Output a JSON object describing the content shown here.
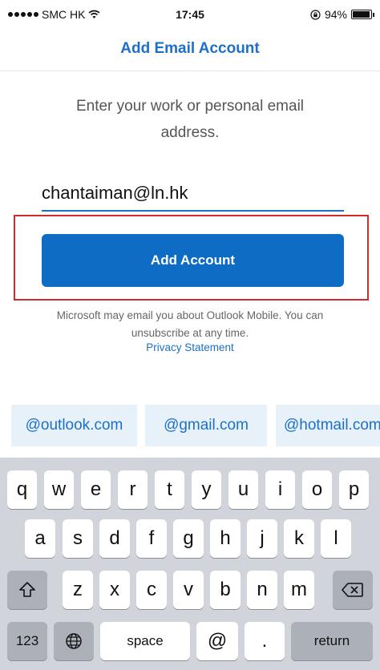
{
  "status_bar": {
    "carrier": "SMC HK",
    "time": "17:45",
    "battery": "94%",
    "battery_level": 0.94
  },
  "nav": {
    "title": "Add Email Account"
  },
  "form": {
    "instruction": "Enter your work or personal email address.",
    "email_value": "chantaiman@ln.hk",
    "add_button": "Add Account",
    "disclaimer": "Microsoft may email you about Outlook Mobile. You can unsubscribe at any time.",
    "privacy_link": "Privacy Statement"
  },
  "suggestions": [
    "@outlook.com",
    "@gmail.com",
    "@hotmail.com"
  ],
  "keyboard": {
    "row1": [
      "q",
      "w",
      "e",
      "r",
      "t",
      "y",
      "u",
      "i",
      "o",
      "p"
    ],
    "row2": [
      "a",
      "s",
      "d",
      "f",
      "g",
      "h",
      "j",
      "k",
      "l"
    ],
    "row3": [
      "z",
      "x",
      "c",
      "v",
      "b",
      "n",
      "m"
    ],
    "numbers_key": "123",
    "space_key": "space",
    "at_key": "@",
    "dot_key": ".",
    "return_key": "return",
    "icons": {
      "shift": "shift-icon",
      "delete": "delete-icon",
      "globe": "globe-icon"
    }
  },
  "colors": {
    "accent": "#1e6fc9",
    "button": "#0f6cc4",
    "highlight": "#d22b2b",
    "chip": "#e7f1fa",
    "keyboard": "#d1d4da"
  }
}
